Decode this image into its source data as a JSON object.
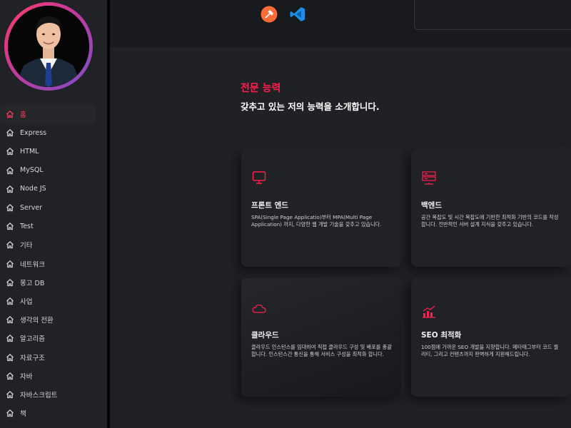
{
  "sidebar": {
    "items": [
      {
        "label": "홈",
        "active": true
      },
      {
        "label": "Express"
      },
      {
        "label": "HTML"
      },
      {
        "label": "MySQL"
      },
      {
        "label": "Node JS"
      },
      {
        "label": "Server"
      },
      {
        "label": "Test"
      },
      {
        "label": "기타"
      },
      {
        "label": "네트워크"
      },
      {
        "label": "몽고 DB"
      },
      {
        "label": "사업"
      },
      {
        "label": "생각의 전환"
      },
      {
        "label": "알고리즘"
      },
      {
        "label": "자료구조"
      },
      {
        "label": "자바"
      },
      {
        "label": "자바스크립트"
      },
      {
        "label": "책"
      }
    ],
    "icon": "home-icon"
  },
  "tools": [
    "postman-icon",
    "vscode-icon"
  ],
  "section": {
    "title": "전문 능력",
    "subtitle": "갖추고 있는 저의 능력을 소개합니다."
  },
  "cards": [
    {
      "title": "프론트 엔드",
      "desc": "SPA(Single Page Applicatio)부터 MPA(Multi Page Application) 까지, 다양한 웹 개발 기술을 갖추고 있습니다.",
      "icon": "monitor-icon"
    },
    {
      "title": "백엔드",
      "desc": "공간 복잡도 및 시간 복잡도에 기반한 최적화 기반의 코드를 작성합니다. 전반적인 서버 설계 지식을 갖추고 있습니다.",
      "icon": "server-icon"
    },
    {
      "title": "클라우드",
      "desc": "클라우드 인스턴스를 임대하여 직접 클라우드 구성 및 배포를 총괄합니다. 인스턴스간 통신을 통해 서비스 구성을 최적화 합니다.",
      "icon": "cloud-icon"
    },
    {
      "title": "SEO 최적화",
      "desc": "100점에 가까운 SEO 개발을 지향합니다. 메타태그부터 코드 퀄리티, 그리고 컨텐츠까지 완벽하게 지원해드립니다.",
      "icon": "chart-icon"
    }
  ],
  "colors": {
    "accent": "#ff1f4f",
    "background": "#1f2125",
    "sidebar": "#202226"
  }
}
